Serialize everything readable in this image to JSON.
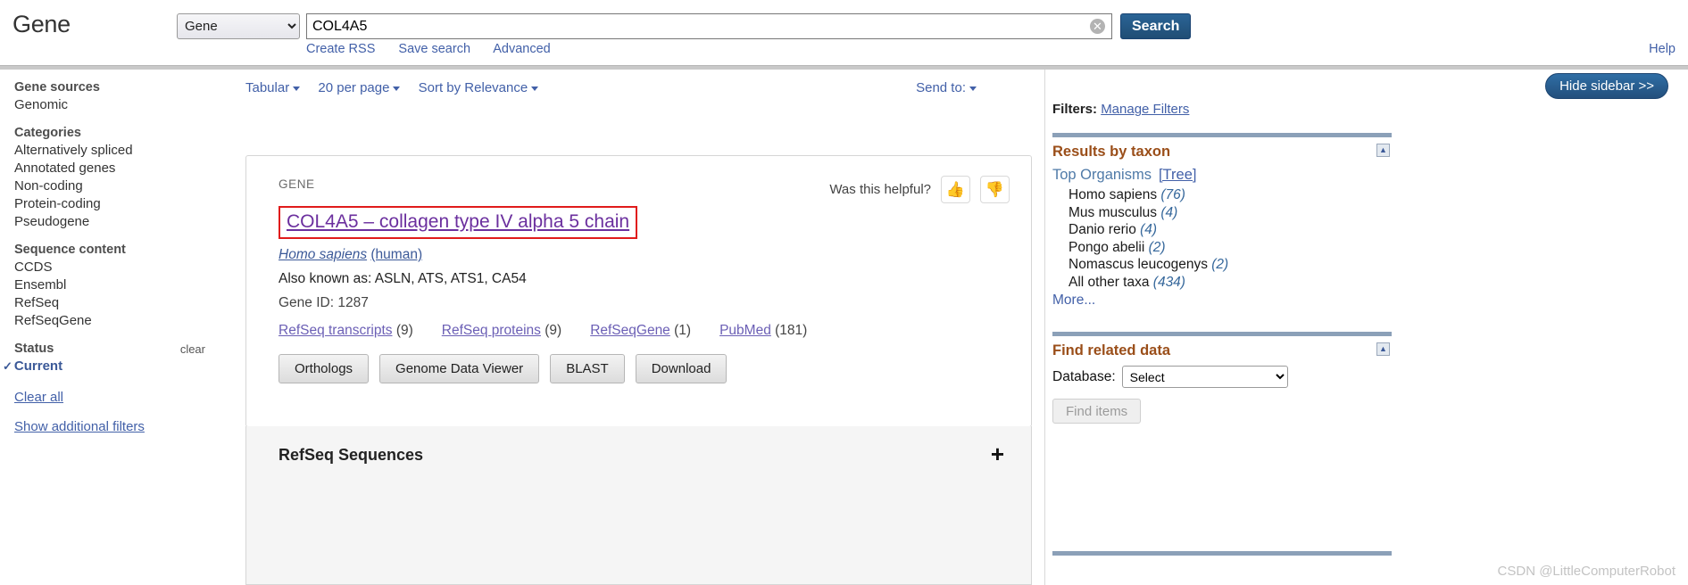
{
  "header": {
    "db_title": "Gene",
    "db_select_value": "Gene",
    "db_select_options": [
      "Gene"
    ],
    "search_value": "COL4A5",
    "search_placeholder": "",
    "clear_icon": "close-circle-icon",
    "search_button": "Search",
    "sublinks": [
      {
        "label": "Create RSS"
      },
      {
        "label": "Save search"
      },
      {
        "label": "Advanced"
      }
    ],
    "help_label": "Help"
  },
  "left_sidebar": {
    "groups": [
      {
        "title": "Gene sources",
        "items": [
          {
            "label": "Genomic",
            "selected": false
          }
        ]
      },
      {
        "title": "Categories",
        "items": [
          {
            "label": "Alternatively spliced",
            "selected": false
          },
          {
            "label": "Annotated genes",
            "selected": false
          },
          {
            "label": "Non-coding",
            "selected": false
          },
          {
            "label": "Protein-coding",
            "selected": false
          },
          {
            "label": "Pseudogene",
            "selected": false
          }
        ]
      },
      {
        "title": "Sequence content",
        "items": [
          {
            "label": "CCDS",
            "selected": false
          },
          {
            "label": "Ensembl",
            "selected": false
          },
          {
            "label": "RefSeq",
            "selected": false
          },
          {
            "label": "RefSeqGene",
            "selected": false
          }
        ]
      },
      {
        "title": "Status",
        "clear_label": "clear",
        "items": [
          {
            "label": "Current",
            "selected": true
          }
        ]
      }
    ],
    "clear_all": "Clear all",
    "show_additional": "Show additional filters"
  },
  "display_bar": {
    "format": "Tabular",
    "per_page": "20 per page",
    "sort": "Sort by Relevance",
    "send_to": "Send to:"
  },
  "result": {
    "kicker": "GENE",
    "helpful_label": "Was this helpful?",
    "thumbs_up_icon": "thumbs-up-icon",
    "thumbs_down_icon": "thumbs-down-icon",
    "title": "COL4A5  –  collagen type IV alpha 5 chain",
    "highlight_color": "#e01b1b",
    "organism_scientific": "Homo sapiens",
    "organism_common": "(human)",
    "also_known_as": "Also known as: ASLN, ATS, ATS1, CA54",
    "gene_id": "Gene ID: 1287",
    "links": [
      {
        "label": "RefSeq transcripts",
        "count": "(9)"
      },
      {
        "label": "RefSeq proteins",
        "count": "(9)"
      },
      {
        "label": "RefSeqGene",
        "count": "(1)"
      },
      {
        "label": "PubMed",
        "count": "(181)"
      }
    ],
    "buttons": [
      "Orthologs",
      "Genome Data Viewer",
      "BLAST",
      "Download"
    ]
  },
  "refseq_panel": {
    "title": "RefSeq Sequences",
    "expand_icon": "plus-icon"
  },
  "right_sidebar": {
    "hide_button": "Hide sidebar >>",
    "filters_label": "Filters:",
    "manage_filters": "Manage Filters",
    "taxon_portlet": {
      "title": "Results by taxon",
      "collapse_icon": "collapse-icon",
      "header": "Top Organisms",
      "tree_link": "[Tree]",
      "items": [
        {
          "name": "Homo sapiens",
          "count": "(76)"
        },
        {
          "name": "Mus musculus",
          "count": "(4)"
        },
        {
          "name": "Danio rerio",
          "count": "(4)"
        },
        {
          "name": "Pongo abelii",
          "count": "(2)"
        },
        {
          "name": "Nomascus leucogenys",
          "count": "(2)"
        },
        {
          "name": "All other taxa",
          "count": "(434)"
        }
      ],
      "more": "More..."
    },
    "related_portlet": {
      "title": "Find related data",
      "collapse_icon": "collapse-icon",
      "database_label": "Database:",
      "database_value": "Select",
      "database_options": [
        "Select"
      ],
      "find_items": "Find items"
    }
  },
  "watermark": "CSDN @LittleComputerRobot"
}
